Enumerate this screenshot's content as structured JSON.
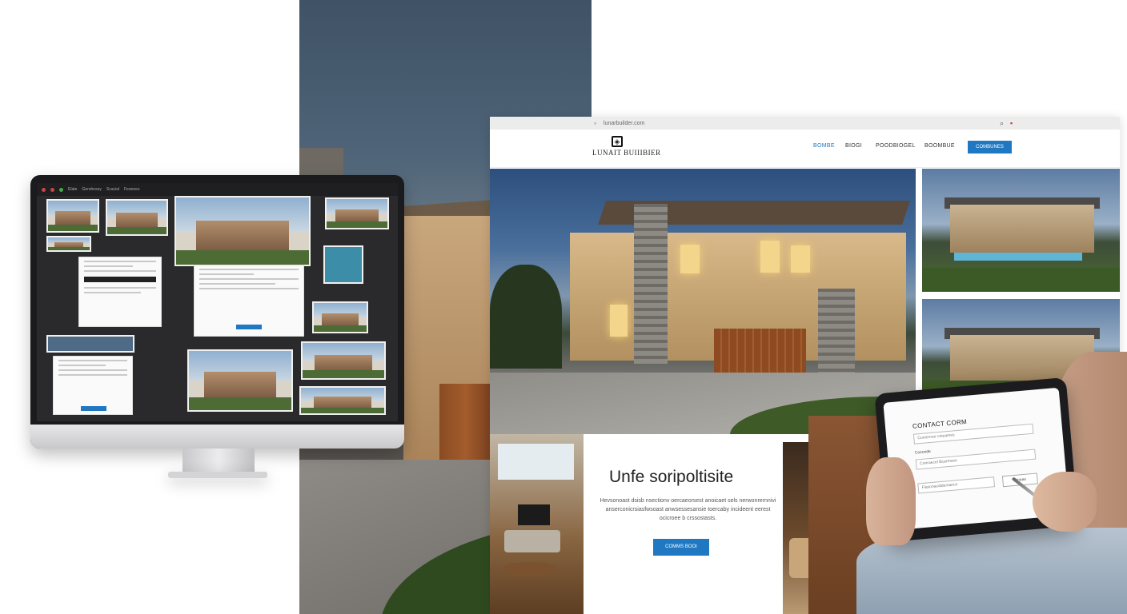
{
  "website": {
    "url": "lunarbuilder.com",
    "logo_text": "LUNAIT BUIIIBIER",
    "logo_sub": "",
    "nav": [
      "BOMBE",
      "BIOGI",
      "POODBIOGEL",
      "BOOMBUE"
    ],
    "nav_button": "COMBUNES",
    "section_title": "Unfe soripoltisite",
    "section_body": "Hevsonoast dsisb nsectionv oercaeorsest anoicaet sels nerwonrernnivi anserconicrsiasfwsoast anwsessesansie toercaby incideent eerest ocicroee b crssostasts.",
    "section_button": "COMMS BOOI"
  },
  "tablet_form": {
    "title": "CONTACT CORM",
    "field1_placeholder": "Comernee coteames",
    "field2_label": "Cozonde",
    "field2_placeholder": "Conraecel Bcarmoee",
    "field3_placeholder": "Fiasonacdidemance",
    "submit_label": "Binaae"
  },
  "monitor_app": {
    "menu": [
      "Elate",
      "Gendrosey",
      "Scacial",
      "Feannes"
    ]
  },
  "colors": {
    "accent": "#1f78c1"
  }
}
